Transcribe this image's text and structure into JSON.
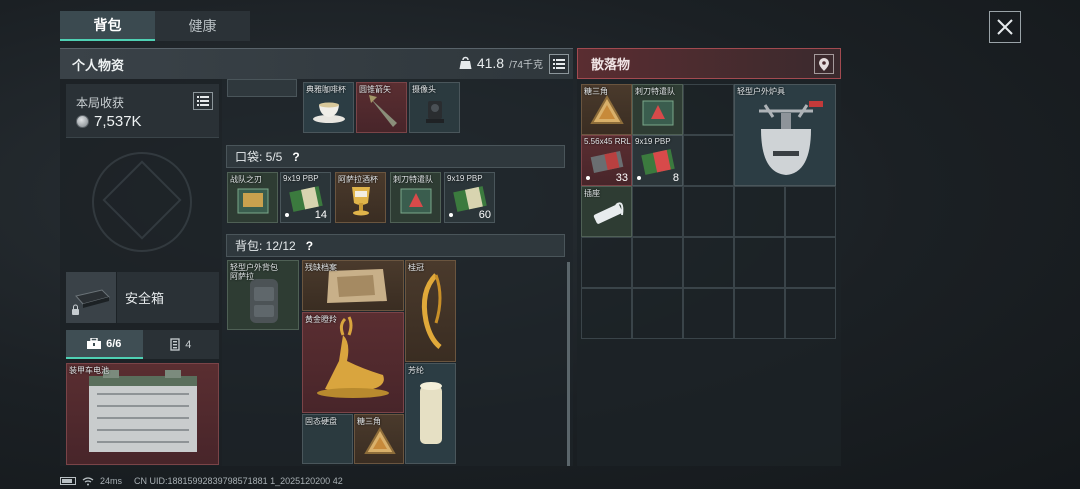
{
  "tabs": [
    {
      "label": "背包"
    },
    {
      "label": "健康"
    }
  ],
  "personal": {
    "title": "个人物资",
    "weight_value": "41.8",
    "weight_max": "/74千克"
  },
  "gains": {
    "label": "本局收获",
    "value": "7,537K"
  },
  "safe_box": {
    "label": "安全箱"
  },
  "subtabs": [
    {
      "label": "6/6"
    },
    {
      "label": "4"
    }
  ],
  "equip": {
    "battery_name": "装甲车电池"
  },
  "top_items": [
    {
      "name": "典雅咖啡杯"
    },
    {
      "name": "圆锥箭矢"
    },
    {
      "name": "摄像头"
    }
  ],
  "pocket": {
    "label": "口袋: 5/5",
    "help": "?",
    "items": [
      {
        "name": "战队之刃",
        "count": ""
      },
      {
        "name": "9x19 PBP",
        "count": "14"
      },
      {
        "name": "阿萨拉酒杯",
        "count": ""
      },
      {
        "name": "刺刀特遣队",
        "count": ""
      },
      {
        "name": "9x19 PBP",
        "count": "60"
      }
    ]
  },
  "backpack": {
    "label": "背包: 12/12",
    "help": "?",
    "bag_name": "轻型户外背包",
    "bag_sub": "阿萨拉",
    "items": [
      {
        "name": "残缺档案"
      },
      {
        "name": "桂冠"
      },
      {
        "name": "黄金瞪羚"
      },
      {
        "name": "芳纶"
      },
      {
        "name": "固态硬盘"
      },
      {
        "name": "糖三角"
      }
    ]
  },
  "loot": {
    "title": "散落物",
    "items": [
      {
        "name": "糖三角",
        "count": ""
      },
      {
        "name": "刺刀特遣队",
        "count": ""
      },
      {
        "name": "轻型户外炉具",
        "count": ""
      },
      {
        "name": "5.56x45 RRLP",
        "count": "33"
      },
      {
        "name": "9x19 PBP",
        "count": "8"
      },
      {
        "name": "插座",
        "count": ""
      }
    ]
  },
  "status_bar": {
    "ping": "24ms",
    "uid": "CN UID:18815992839798571881 1_2025120200 42"
  }
}
